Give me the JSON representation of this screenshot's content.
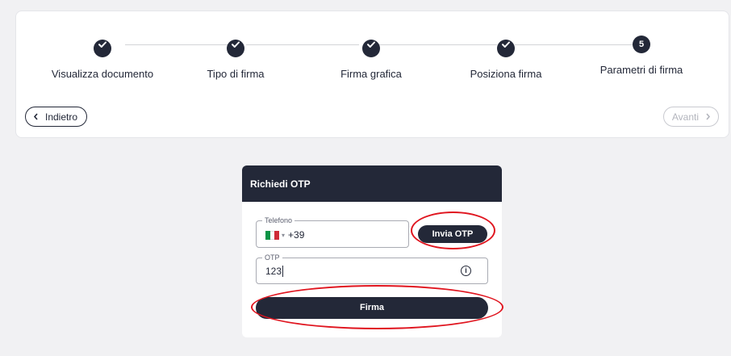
{
  "stepper": {
    "steps": [
      {
        "label": "Visualizza documento",
        "state": "done"
      },
      {
        "label": "Tipo di firma",
        "state": "done"
      },
      {
        "label": "Firma grafica",
        "state": "done"
      },
      {
        "label": "Posiziona firma",
        "state": "done"
      },
      {
        "label": "Parametri di firma",
        "state": "active",
        "number": "5"
      }
    ],
    "back_label": "Indietro",
    "next_label": "Avanti"
  },
  "otp_card": {
    "title": "Richiedi OTP",
    "phone": {
      "legend": "Telefono",
      "country_flag": "flag-italy-icon",
      "prefix": "+39"
    },
    "send_otp_label": "Invia OTP",
    "otp": {
      "legend": "OTP",
      "value": "123"
    },
    "sign_label": "Firma"
  },
  "colors": {
    "primary": "#232838",
    "background": "#f1f1f3",
    "annotation": "#e0151f",
    "disabled": "#b3b5bd"
  }
}
